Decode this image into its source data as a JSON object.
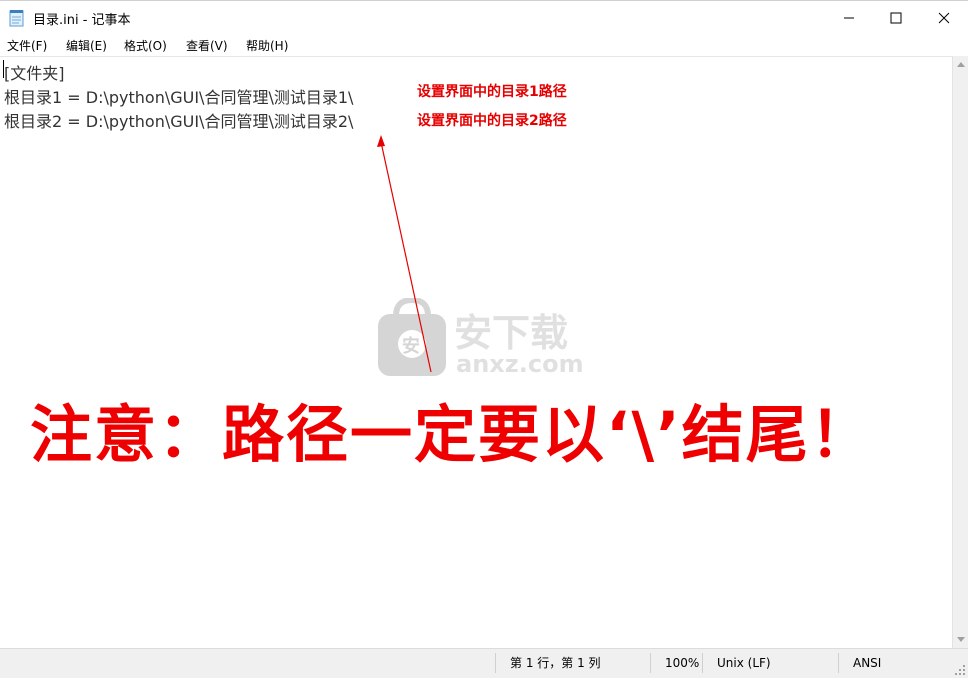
{
  "window": {
    "title": "目录.ini - 记事本"
  },
  "menu": [
    {
      "label": "文件(F)"
    },
    {
      "label": "编辑(E)"
    },
    {
      "label": "格式(O)"
    },
    {
      "label": "查看(V)"
    },
    {
      "label": "帮助(H)"
    }
  ],
  "editor": {
    "lines": [
      "[文件夹]",
      "根目录1 = D:\\python\\GUI\\合同管理\\测试目录1\\",
      "根目录2 = D:\\python\\GUI\\合同管理\\测试目录2\\"
    ]
  },
  "annotations": {
    "note1": "设置界面中的目录1路径",
    "note2": "设置界面中的目录2路径",
    "warning": "注意：路径一定要以‘\\’结尾！",
    "color": "#e60000"
  },
  "watermark": {
    "brand": "安下载",
    "domain": "anxz.com",
    "badge": "安"
  },
  "statusbar": {
    "position": "第 1 行，第 1 列",
    "zoom": "100%",
    "line_ending": "Unix (LF)",
    "encoding": "ANSI"
  },
  "icons": {
    "app": "notepad-icon",
    "minimize": "minimize-icon",
    "maximize": "maximize-icon",
    "close": "close-icon"
  }
}
